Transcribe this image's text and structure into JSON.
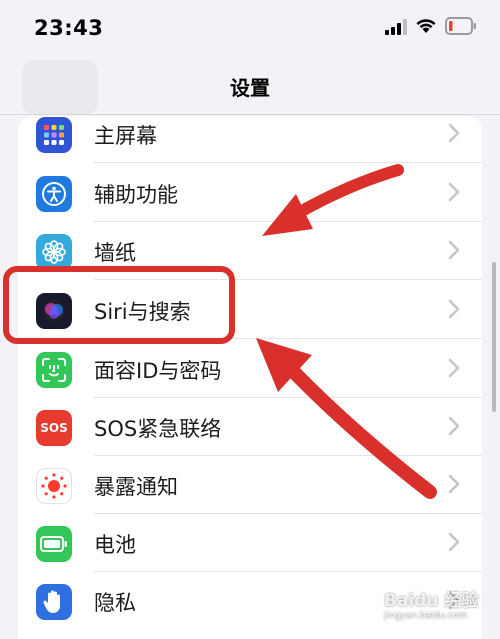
{
  "status_bar": {
    "time": "23:43",
    "icons": [
      "cellular-signal-icon",
      "wifi-icon",
      "battery-low-icon"
    ]
  },
  "nav": {
    "title": "设置"
  },
  "settings": {
    "items": [
      {
        "label": "主屏幕",
        "icon": "home-screen-grid-icon",
        "color": "#2f55d4"
      },
      {
        "label": "辅助功能",
        "icon": "accessibility-icon",
        "color": "#1f7ae0"
      },
      {
        "label": "墙纸",
        "icon": "wallpaper-flower-icon",
        "color": "#34aadc"
      },
      {
        "label": "Siri与搜索",
        "icon": "siri-icon",
        "color": "#1a1a2e"
      },
      {
        "label": "面容ID与密码",
        "icon": "face-id-icon",
        "color": "#33c659"
      },
      {
        "label": "SOS紧急联络",
        "icon": "sos-icon",
        "color": "#e63b2e",
        "icon_text": "SOS"
      },
      {
        "label": "暴露通知",
        "icon": "exposure-notification-icon",
        "color": "#ffffff"
      },
      {
        "label": "电池",
        "icon": "battery-icon",
        "color": "#33c659"
      },
      {
        "label": "隐私",
        "icon": "privacy-hand-icon",
        "color": "#2f6fe0"
      }
    ]
  },
  "annotation": {
    "highlight_color": "#d9302c"
  },
  "watermark": {
    "text": "Baidu 经验",
    "sub": "jingyan.baidu.com"
  }
}
